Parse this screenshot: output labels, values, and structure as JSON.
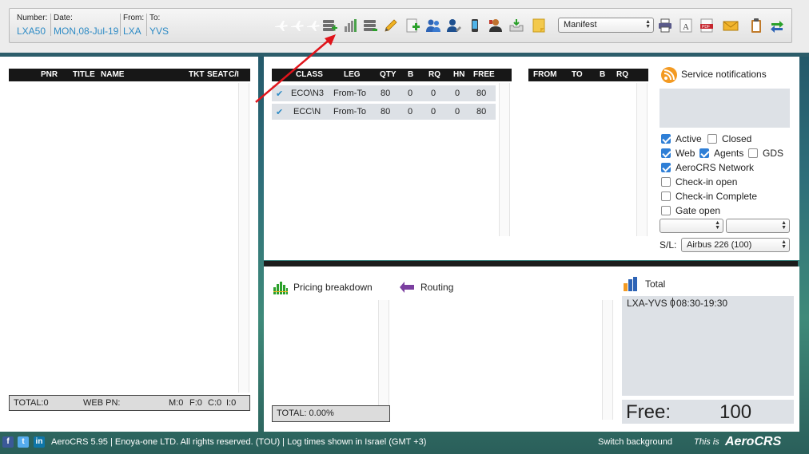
{
  "header": {
    "number_label": "Number:",
    "number_value": "LXA50",
    "date_label": "Date:",
    "date_value": "MON,08-Jul-19",
    "from_label": "From:",
    "from_value": "LXA",
    "to_label": "To:",
    "to_value": "YVS",
    "report_select": "Manifest",
    "toolbar_icons": [
      "plane-icon",
      "plane-icon",
      "plane-icon",
      "database-add-icon",
      "bar-chart-icon",
      "database-icon",
      "pencil-icon",
      "page-add-icon",
      "users-icon",
      "user-edit-icon",
      "mobile-icon",
      "agent-icon",
      "inbox-icon",
      "note-icon",
      "printer-icon",
      "font-icon",
      "pdf-icon",
      "mail-icon",
      "clipboard-icon",
      "refresh-icon"
    ]
  },
  "passenger_list": {
    "columns": [
      "PNR",
      "TITLE",
      "NAME",
      "TKT",
      "SEAT",
      "C/I"
    ],
    "totals": {
      "total": "TOTAL:0",
      "web_pn": "WEB PN:",
      "m": "M:0",
      "f": "F:0",
      "c": "C:0",
      "i": "I:0"
    }
  },
  "class_table": {
    "columns": [
      "CLASS",
      "LEG",
      "QTY",
      "B",
      "RQ",
      "HN",
      "FREE"
    ],
    "rows": [
      {
        "class": "ECO\\N3",
        "leg": "From-To",
        "qty": "80",
        "b": "0",
        "rq": "0",
        "hn": "0",
        "free": "80"
      },
      {
        "class": "ECC\\N",
        "leg": "From-To",
        "qty": "80",
        "b": "0",
        "rq": "0",
        "hn": "0",
        "free": "80"
      }
    ]
  },
  "route_table": {
    "columns": [
      "FROM",
      "TO",
      "B",
      "RQ"
    ]
  },
  "service_notifications": {
    "title": "Service notifications",
    "checkboxes": [
      {
        "label": "Active",
        "checked": true
      },
      {
        "label": "Closed",
        "checked": false
      },
      {
        "label": "Web",
        "checked": true
      },
      {
        "label": "Agents",
        "checked": true
      },
      {
        "label": "GDS",
        "checked": false
      },
      {
        "label": "AeroCRS Network",
        "checked": true
      },
      {
        "label": "Check-in open",
        "checked": false
      },
      {
        "label": "Check-in Complete",
        "checked": false
      },
      {
        "label": "Gate open",
        "checked": false
      }
    ],
    "sl_label": "S/L:",
    "sl_value": "Airbus 226 (100)"
  },
  "pricing": {
    "title": "Pricing breakdown",
    "total": "TOTAL: 0.00%"
  },
  "routing": {
    "title": "Routing"
  },
  "total_panel": {
    "title": "Total",
    "leg": "LXA-YVS 0",
    "time": "08:30-19:30",
    "free_label": "Free:",
    "free_value": "100"
  },
  "footer": {
    "copyright": "AeroCRS 5.95  | Enoya-one LTD. All rights reserved. (TOU)  | Log times shown in Israel (GMT +3)",
    "switch_background": "Switch background",
    "this_is": "This is",
    "brand": "AeroCRS"
  },
  "colors": {
    "accent_blue": "#2e8bc5",
    "annotation_arrow": "#e0141b"
  }
}
